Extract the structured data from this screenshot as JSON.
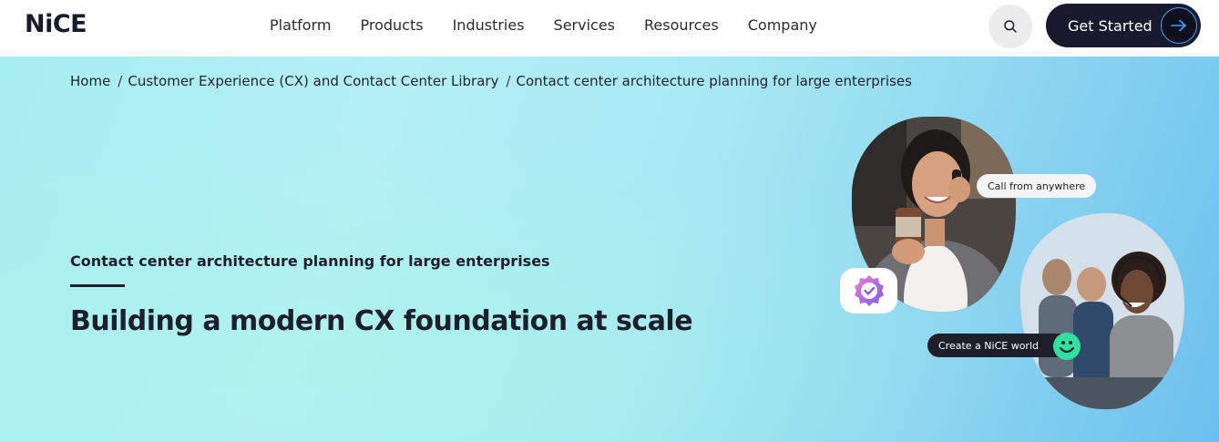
{
  "brand": {
    "logo_text": "NiCE",
    "accent": "#2aa8f0"
  },
  "nav": {
    "items": [
      {
        "label": "Platform"
      },
      {
        "label": "Products"
      },
      {
        "label": "Industries"
      },
      {
        "label": "Services"
      },
      {
        "label": "Resources"
      },
      {
        "label": "Company"
      }
    ],
    "search_icon": "search-icon",
    "cta_label": "Get Started",
    "cta_icon": "arrow-right-icon"
  },
  "breadcrumb": {
    "items": [
      {
        "label": "Home"
      },
      {
        "label": "Customer Experience (CX) and Contact Center Library"
      },
      {
        "label": "Contact center architecture planning for large enterprises"
      }
    ],
    "separator": "/"
  },
  "hero": {
    "eyebrow": "Contact center architecture planning for large enterprises",
    "headline": "Building a modern CX foundation at scale",
    "bubble_call": "Call from anywhere",
    "bubble_create": "Create a NiCE world",
    "badge_icon": "verified-badge-icon",
    "smiley_icon": "smiley-icon",
    "photo_1": "woman-on-phone-photo",
    "photo_2": "agents-with-headsets-photo"
  },
  "colors": {
    "header_bg": "#ffffff",
    "dark": "#1a1a2e",
    "hero_from": "#a7eef0",
    "hero_to": "#6cc0ee",
    "badge_purple": "#8a5cf6",
    "smiley_green": "#2fe0a0"
  }
}
